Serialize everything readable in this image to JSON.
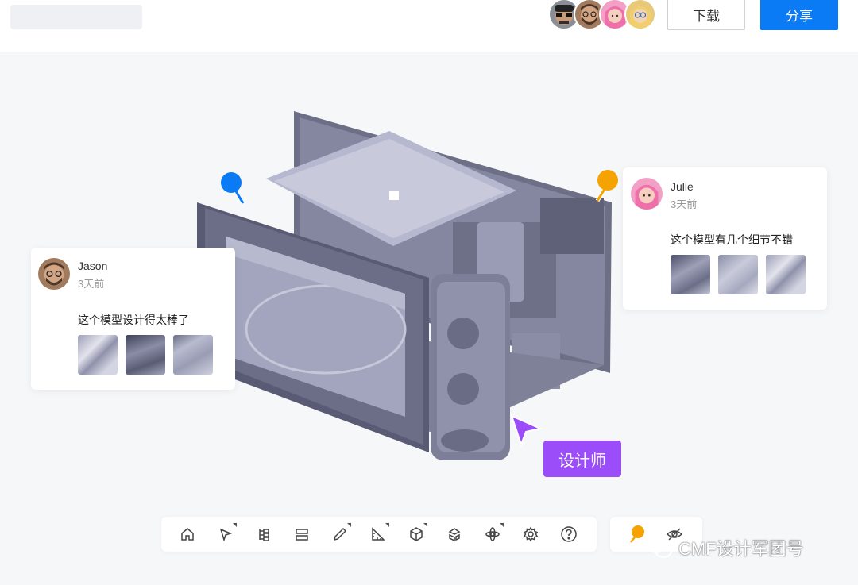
{
  "header": {
    "download_label": "下载",
    "share_label": "分享",
    "collaborators": [
      {
        "avatar": "avatar-man-cap-sunglasses",
        "color": "#8a8f96"
      },
      {
        "avatar": "avatar-man-glasses-beard",
        "color": "#a27a5e"
      },
      {
        "avatar": "avatar-woman-pink-hair",
        "color": "#f2a0c6"
      },
      {
        "avatar": "avatar-woman-blonde-glasses",
        "color": "#e8c979"
      }
    ]
  },
  "model": {
    "icon": "microwave-3d-model"
  },
  "pins": {
    "blue": {
      "color": "#0a7af5"
    },
    "orange": {
      "color": "#f5a300"
    }
  },
  "comments": [
    {
      "name": "Jason",
      "time": "3天前",
      "text": "这个模型设计得太棒了",
      "avatar": "avatar-man-glasses-beard",
      "thumbnails": 3
    },
    {
      "name": "Julie",
      "time": "3天前",
      "text": "这个模型有几个细节不错",
      "avatar": "avatar-woman-pink-hair",
      "thumbnails": 3
    }
  ],
  "designer": {
    "label": "设计师",
    "color": "#9b4dfa"
  },
  "toolbar": {
    "tools": [
      {
        "name": "home-icon"
      },
      {
        "name": "select-cursor-icon"
      },
      {
        "name": "tree-structure-icon"
      },
      {
        "name": "layers-icon"
      },
      {
        "name": "pencil-icon"
      },
      {
        "name": "measure-icon"
      },
      {
        "name": "section-box-icon"
      },
      {
        "name": "explode-icon"
      },
      {
        "name": "rotate-axis-icon"
      },
      {
        "name": "settings-icon"
      },
      {
        "name": "help-icon"
      }
    ],
    "extra": [
      {
        "name": "comment-pin-icon"
      },
      {
        "name": "visibility-icon"
      }
    ]
  },
  "watermark": {
    "text": "CMF设计军团号"
  }
}
